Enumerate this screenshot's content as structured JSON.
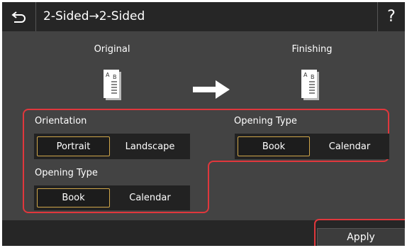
{
  "header": {
    "title": "2-Sided→2-Sided",
    "back_icon": "back-arrow-icon",
    "help_label": "?"
  },
  "original": {
    "label": "Original"
  },
  "finishing": {
    "label": "Finishing"
  },
  "original_settings": {
    "orientation": {
      "label": "Orientation",
      "options": [
        "Portrait",
        "Landscape"
      ],
      "selected": "Portrait"
    },
    "opening_type": {
      "label": "Opening Type",
      "options": [
        "Book",
        "Calendar"
      ],
      "selected": "Book"
    }
  },
  "finishing_settings": {
    "opening_type": {
      "label": "Opening Type",
      "options": [
        "Book",
        "Calendar"
      ],
      "selected": "Book"
    }
  },
  "footer": {
    "apply_label": "Apply"
  },
  "colors": {
    "highlight_outline": "#e0373c",
    "selected_border": "#cfa64a",
    "background": "#434343",
    "bar": "#262626"
  }
}
